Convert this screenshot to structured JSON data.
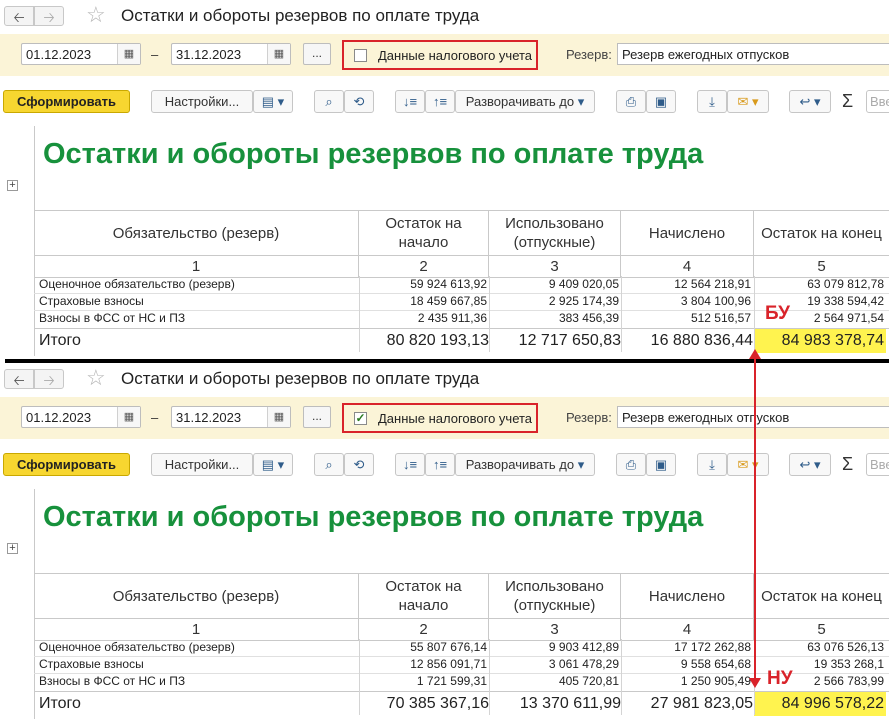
{
  "window_title": "Остатки и обороты резервов по оплате труда",
  "filters": {
    "date_from": "01.12.2023",
    "date_to": "31.12.2023",
    "dash": "–",
    "ellipsis": "...",
    "tax_label": "Данные налогового учета",
    "reserve_label": "Резерв:",
    "reserve_value": "Резерв ежегодных отпусков"
  },
  "toolbar": {
    "generate": "Сформировать",
    "settings": "Настройки...",
    "expand_to": "Разворачивать до",
    "sum_symbol": "Σ",
    "search_placeholder": "Вве"
  },
  "report": {
    "title": "Остатки и обороты резервов по оплате труда",
    "columns": [
      {
        "label": "Обязательство (резерв)",
        "num": "1"
      },
      {
        "label": "Остаток на начало",
        "num": "2"
      },
      {
        "label": "Использовано (отпускные)",
        "num": "3"
      },
      {
        "label": "Начислено",
        "num": "4"
      },
      {
        "label": "Остаток на конец",
        "num": "5"
      }
    ]
  },
  "panels": [
    {
      "tax_checked": false,
      "rows": [
        [
          "Оценочное обязательство (резерв)",
          "59 924 613,92",
          "9 409 020,05",
          "12 564 218,91",
          "63 079 812,78"
        ],
        [
          "Страховые взносы",
          "18 459 667,85",
          "2 925 174,39",
          "3 804 100,96",
          "19 338 594,42"
        ],
        [
          "Взносы в ФСС от НС и ПЗ",
          "2 435 911,36",
          "383 456,39",
          "512 516,57",
          "2 564 971,54"
        ]
      ],
      "total": [
        "Итого",
        "80 820 193,13",
        "12 717 650,83",
        "16 880 836,44",
        "84 983 378,74"
      ],
      "tag": "БУ"
    },
    {
      "tax_checked": true,
      "rows": [
        [
          "Оценочное обязательство (резерв)",
          "55 807 676,14",
          "9 903 412,89",
          "17 172 262,88",
          "63 076 526,13"
        ],
        [
          "Страховые взносы",
          "12 856 091,71",
          "3 061 478,29",
          "9 558 654,68",
          "19 353 268,1"
        ],
        [
          "Взносы в ФСС от НС и ПЗ",
          "1 721 599,31",
          "405 720,81",
          "1 250 905,49",
          "2 566 783,99"
        ]
      ],
      "total": [
        "Итого",
        "70 385 367,16",
        "13 370 611,99",
        "27 981 823,05",
        "84 996 578,22"
      ],
      "tag": "НУ"
    }
  ],
  "colors": {
    "accent_green": "#17913c",
    "highlight_yellow": "#fff34f",
    "annotation_red": "#d9232a",
    "button_yellow": "#f7d630"
  }
}
